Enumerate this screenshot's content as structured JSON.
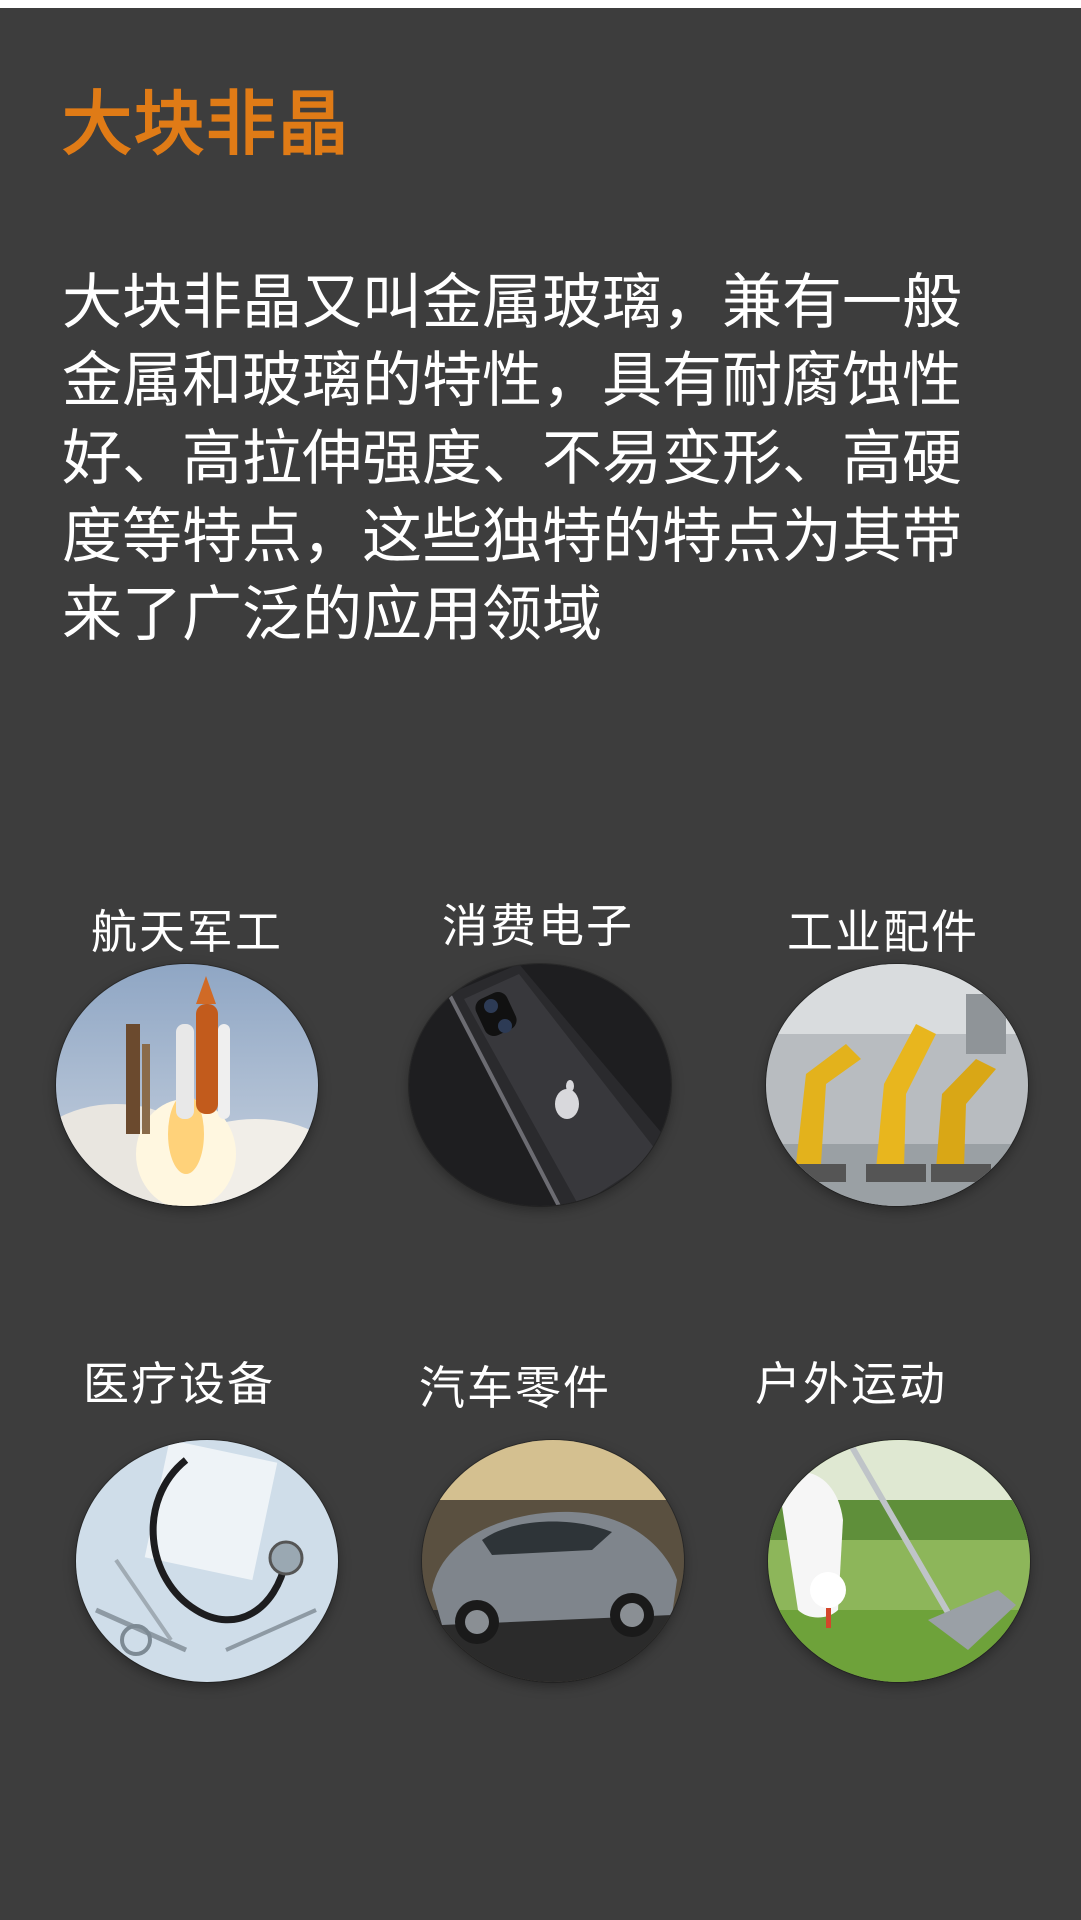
{
  "title": "大块非晶",
  "title_color": "#e07b16",
  "description_lines": [
    "大块非晶又叫金属玻璃，兼有一般",
    "金属和玻璃的特性，具有耐腐蚀性",
    "好、高拉伸强度、不易变形、高硬",
    "度等特点，这些独特的特点为其带",
    "来了广泛的应用领域"
  ],
  "applications": [
    {
      "label": "航天军工",
      "icon": "space-shuttle-launch-photo"
    },
    {
      "label": "消费电子",
      "icon": "smartphone-photo"
    },
    {
      "label": "工业配件",
      "icon": "industrial-robot-arms-photo"
    },
    {
      "label": "医疗设备",
      "icon": "medical-stethoscope-photo"
    },
    {
      "label": "汽车零件",
      "icon": "sports-car-photo"
    },
    {
      "label": "户外运动",
      "icon": "golf-club-ball-photo"
    }
  ]
}
